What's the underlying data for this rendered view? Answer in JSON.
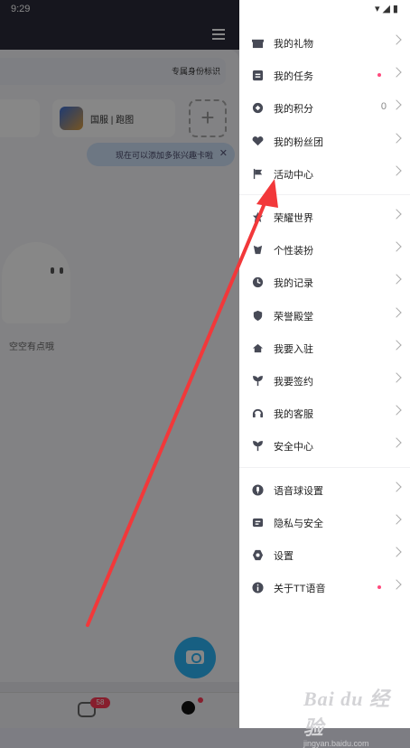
{
  "status_bar": {
    "time": "9:29",
    "icons": "▾◢▮"
  },
  "background": {
    "id_label": "专属身份标识",
    "game_card_label": "国服 | 跑图",
    "add_symbol": "+",
    "tip_text": "现在可以添加多张兴趣卡啦",
    "tip_close": "✕",
    "empty_text": "空空有点哦",
    "chat_badge": "58"
  },
  "menu_groups": [
    [
      {
        "icon": "gift-icon",
        "label": "我的礼物"
      },
      {
        "icon": "task-icon",
        "label": "我的任务",
        "dot": true
      },
      {
        "icon": "points-icon",
        "label": "我的积分",
        "count": "0"
      },
      {
        "icon": "fan-club-icon",
        "label": "我的粉丝团"
      },
      {
        "icon": "flag-icon",
        "label": "活动中心"
      }
    ],
    [
      {
        "icon": "glory-world-icon",
        "label": "荣耀世界"
      },
      {
        "icon": "dress-up-icon",
        "label": "个性装扮"
      },
      {
        "icon": "record-icon",
        "label": "我的记录"
      },
      {
        "icon": "honor-hall-icon",
        "label": "荣誉殿堂"
      },
      {
        "icon": "house-icon",
        "label": "我要入驻"
      },
      {
        "icon": "sign-icon",
        "label": "我要签约"
      },
      {
        "icon": "service-icon",
        "label": "我的客服"
      },
      {
        "icon": "security-icon",
        "label": "安全中心"
      }
    ],
    [
      {
        "icon": "mic-icon",
        "label": "语音球设置"
      },
      {
        "icon": "privacy-icon",
        "label": "隐私与安全"
      },
      {
        "icon": "gear-icon",
        "label": "设置"
      },
      {
        "icon": "info-icon",
        "label": "关于TT语音",
        "dot": true
      }
    ]
  ],
  "watermark": {
    "main": "Bai du 经验",
    "sub": "jingyan.baidu.com"
  },
  "colors": {
    "accent_blue": "#2db3f5",
    "badge_red": "#ff3a55",
    "dot_pink": "#ff4a7d",
    "arrow_red": "#f2383a"
  }
}
